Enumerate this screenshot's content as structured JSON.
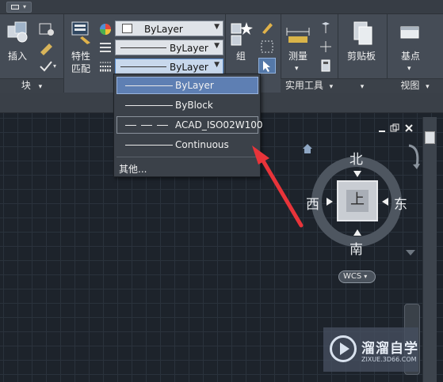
{
  "ribbon": {
    "insert_label": "插入",
    "block_panel_label": "块",
    "match_props_label_1": "特性",
    "match_props_label_2": "匹配",
    "group_label": "组",
    "measure_label": "测量",
    "utilities_panel_label": "实用工具",
    "clipboard_label": "剪贴板",
    "basepoint_label": "基点",
    "view_panel_label": "视图",
    "combos": {
      "color": "ByLayer",
      "linetype": "ByLayer",
      "lineweight": "ByLayer"
    }
  },
  "dropdown": {
    "items": [
      {
        "label": "ByLayer"
      },
      {
        "label": "ByBlock"
      },
      {
        "label": "ACAD_ISO02W100"
      },
      {
        "label": "Continuous"
      }
    ],
    "other_label": "其他..."
  },
  "viewcube": {
    "north": "北",
    "south": "南",
    "east": "东",
    "west": "西",
    "face": "上",
    "wcs_label": "WCS"
  },
  "watermark": {
    "title": "溜溜自学",
    "url": "ZIXUE.3D66.COM"
  },
  "colors": {
    "accent_arrow": "#e8343a",
    "highlight": "#5e7fb3"
  }
}
